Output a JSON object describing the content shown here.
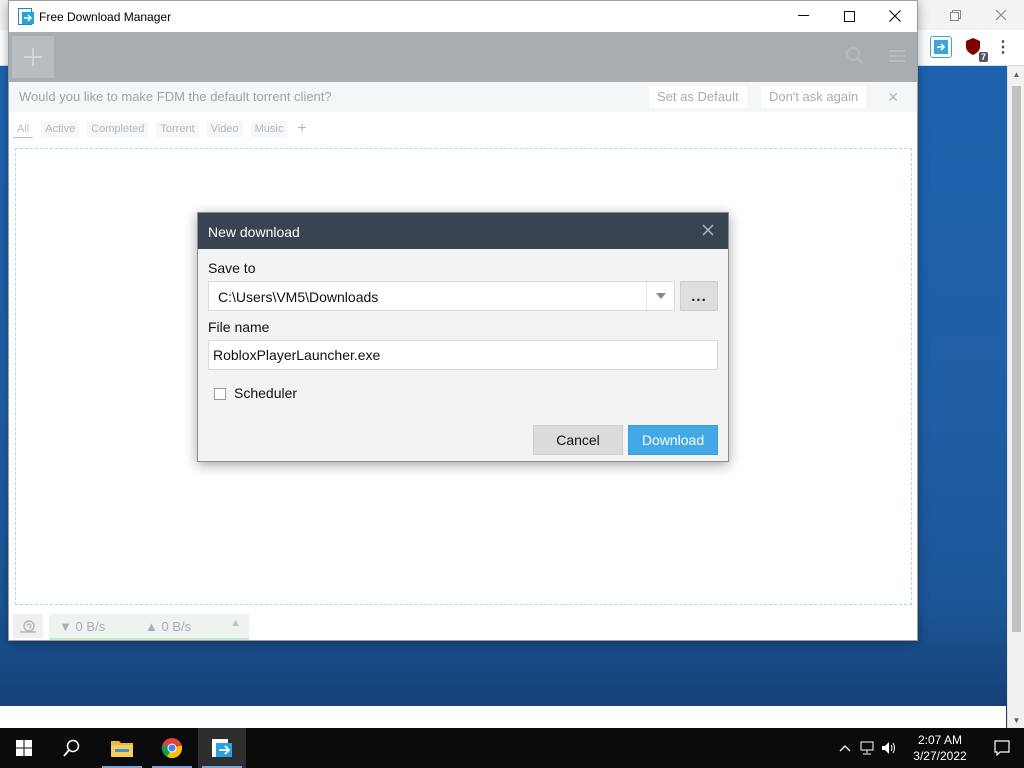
{
  "window": {
    "title": "Free Download Manager"
  },
  "notification": {
    "text": "Would you like to make FDM the default torrent client?",
    "set_default_label": "Set as Default",
    "dont_ask_label": "Don't ask again"
  },
  "filter_tabs": [
    "All",
    "Active",
    "Completed",
    "Torrent",
    "Video",
    "Music"
  ],
  "status": {
    "download_speed": "0 B/s",
    "upload_speed": "0 B/s"
  },
  "dialog": {
    "title": "New download",
    "save_to_label": "Save to",
    "save_to_value": "C:\\Users\\VM5\\Downloads",
    "browse_label": "...",
    "file_name_label": "File name",
    "file_name_value": "RobloxPlayerLauncher.exe",
    "scheduler_label": "Scheduler",
    "scheduler_checked": false,
    "cancel_label": "Cancel",
    "download_label": "Download"
  },
  "extensions": {
    "ublock_badge": "7"
  },
  "taskbar": {
    "clock_time": "2:07 AM",
    "clock_date": "3/27/2022"
  },
  "colors": {
    "accent": "#42a9e6",
    "dialog_header": "#3a4351",
    "dropzone_border": "#a7d9ed"
  },
  "icons": {
    "app": "fdm-icon",
    "add": "plus-icon",
    "search": "search-icon",
    "menu": "hamburger-icon",
    "snail": "snail-icon",
    "close": "close-icon",
    "dropdown": "chevron-down-icon",
    "start": "windows-start-icon",
    "file_explorer": "folder-icon",
    "chrome": "chrome-icon"
  }
}
